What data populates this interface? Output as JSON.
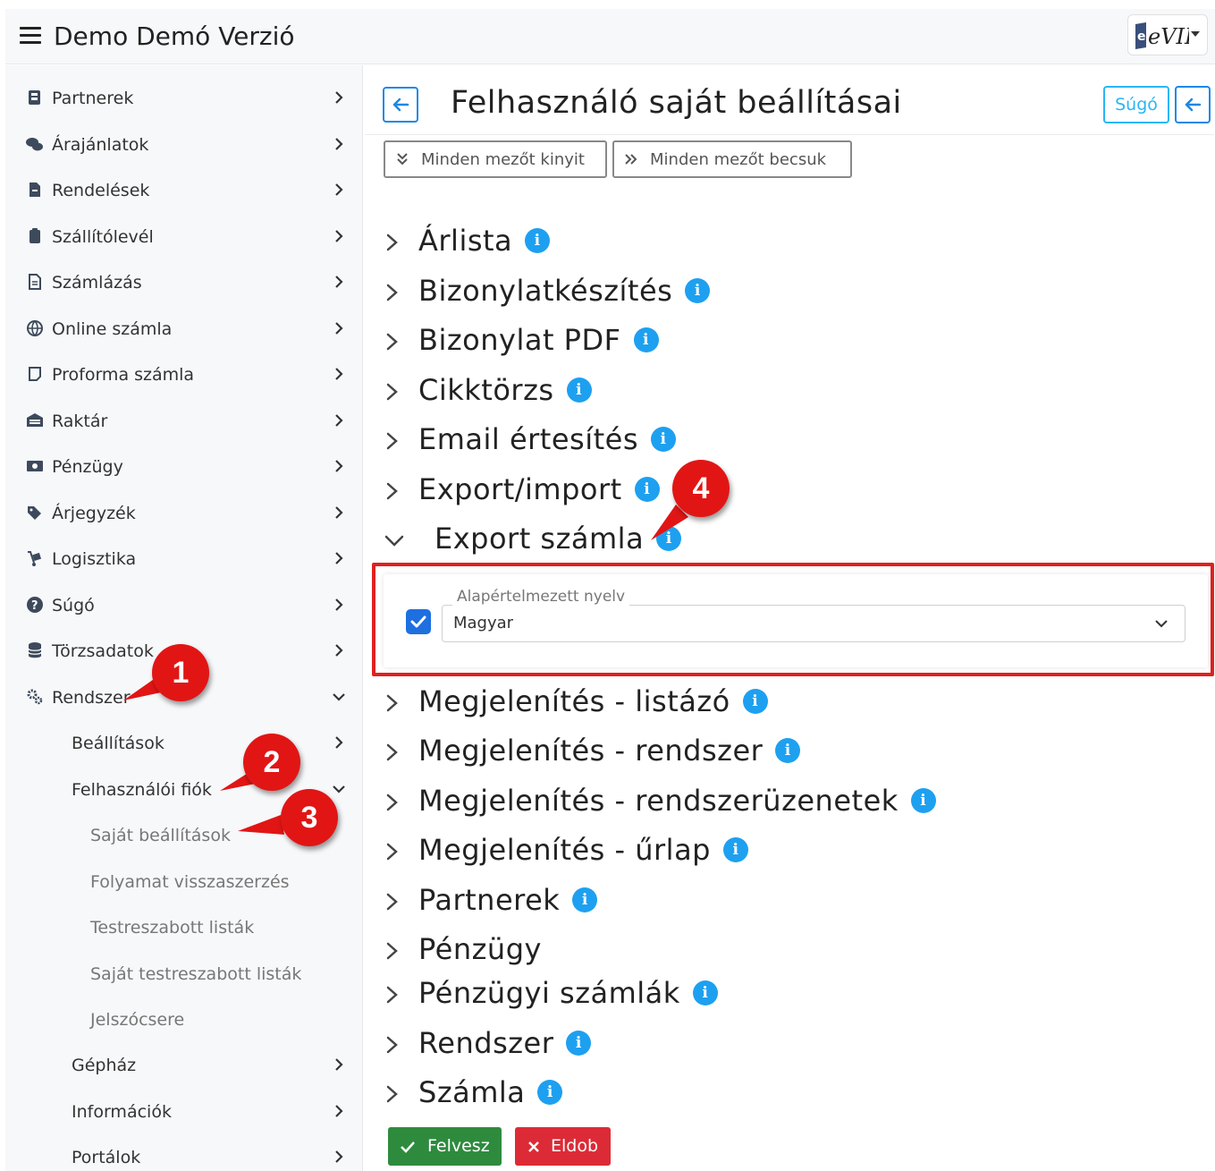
{
  "app": {
    "title": "Demo Demó Verzió",
    "logo_text": "eVIR"
  },
  "sidebar": {
    "items": [
      {
        "label": "Partnerek",
        "icon": "address-book-icon"
      },
      {
        "label": "Árajánlatok",
        "icon": "comments-icon"
      },
      {
        "label": "Rendelések",
        "icon": "file-icon"
      },
      {
        "label": "Szállítólevél",
        "icon": "clipboard-icon"
      },
      {
        "label": "Számlázás",
        "icon": "file-text-icon"
      },
      {
        "label": "Online számla",
        "icon": "globe-icon"
      },
      {
        "label": "Proforma számla",
        "icon": "square-icon"
      },
      {
        "label": "Raktár",
        "icon": "warehouse-icon"
      },
      {
        "label": "Pénzügy",
        "icon": "money-icon"
      },
      {
        "label": "Árjegyzék",
        "icon": "tags-icon"
      },
      {
        "label": "Logisztika",
        "icon": "dolly-icon"
      },
      {
        "label": "Súgó",
        "icon": "question-circle-icon"
      },
      {
        "label": "Törzsadatok",
        "icon": "database-icon"
      },
      {
        "label": "Rendszer",
        "icon": "cogs-icon"
      }
    ],
    "sub_items": [
      {
        "label": "Beállítások"
      },
      {
        "label": "Felhasználói fiók"
      }
    ],
    "subsub_items": [
      {
        "label": "Saját beállítások"
      },
      {
        "label": "Folyamat visszaszerzés"
      },
      {
        "label": "Testreszabott listák"
      },
      {
        "label": "Saját testreszabott listák"
      },
      {
        "label": "Jelszócsere"
      }
    ],
    "bottom_items": [
      {
        "label": "Gépház"
      },
      {
        "label": "Információk"
      },
      {
        "label": "Portálok"
      }
    ]
  },
  "main": {
    "title": "Felhasználó saját beállításai",
    "help_label": "Súgó",
    "expand_all_label": "Minden mezőt kinyit",
    "collapse_all_label": "Minden mezőt becsuk",
    "sections_before": [
      {
        "title": "Árlista",
        "info": true
      },
      {
        "title": "Bizonylatkészítés",
        "info": true
      },
      {
        "title": "Bizonylat PDF",
        "info": true
      },
      {
        "title": "Cikktörzs",
        "info": true
      },
      {
        "title": "Email értesítés",
        "info": true
      },
      {
        "title": "Export/import",
        "info": true
      }
    ],
    "expanded_section": {
      "title": "Export számla",
      "field_label": "Alapértelmezett nyelv",
      "field_value": "Magyar",
      "checkbox_checked": true
    },
    "sections_after": [
      {
        "title": "Megjelenítés - listázó",
        "info": true
      },
      {
        "title": "Megjelenítés - rendszer",
        "info": true
      },
      {
        "title": "Megjelenítés - rendszerüzenetek",
        "info": true
      },
      {
        "title": "Megjelenítés - űrlap",
        "info": true
      },
      {
        "title": "Partnerek",
        "info": true
      },
      {
        "title": "Pénzügy",
        "info": false
      },
      {
        "title": "Pénzügyi számlák",
        "info": true
      },
      {
        "title": "Rendszer",
        "info": true
      },
      {
        "title": "Számla",
        "info": true
      }
    ],
    "save_label": "Felvesz",
    "discard_label": "Eldob",
    "info_glyph": "i"
  },
  "callouts": [
    "1",
    "2",
    "3",
    "4"
  ],
  "colors": {
    "accent": "#1e88e5",
    "info": "#1ea0f0",
    "save": "#2e8b3e",
    "discard": "#dc2b36",
    "callout": "#e21515"
  }
}
